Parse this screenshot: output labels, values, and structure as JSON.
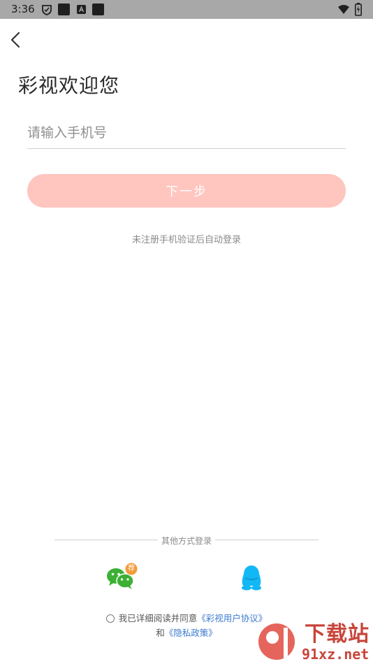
{
  "status_bar": {
    "time": "3:36",
    "icons": [
      "vpn-key-icon",
      "notification-square-icon",
      "app-a-icon",
      "notification-square-icon",
      "wifi-icon",
      "battery-charging-icon"
    ]
  },
  "header": {
    "back_icon": "chevron-left-icon",
    "title": "彩视欢迎您"
  },
  "login_form": {
    "phone_placeholder": "请输入手机号",
    "phone_value": "",
    "next_button_label": "下一步",
    "hint": "未注册手机验证后自动登录"
  },
  "other_login": {
    "label": "其他方式登录",
    "options": [
      {
        "icon": "wechat-icon",
        "badge": "荐"
      },
      {
        "icon": "qq-icon"
      }
    ]
  },
  "agreement": {
    "prefix": "我已详细阅读并同意",
    "user_agreement": "《彩视用户协议》",
    "conjunction": "和",
    "privacy_policy": "《隐私政策》"
  },
  "watermark": {
    "text_cn": "下载站",
    "text_en": "91xz.net"
  },
  "colors": {
    "accent": "#ffc5bf",
    "link": "#3b7ad0",
    "wechat": "#3cb034",
    "qq": "#12b7f5",
    "badge": "#f39a3b",
    "status_bar": "#a8a8a8"
  }
}
